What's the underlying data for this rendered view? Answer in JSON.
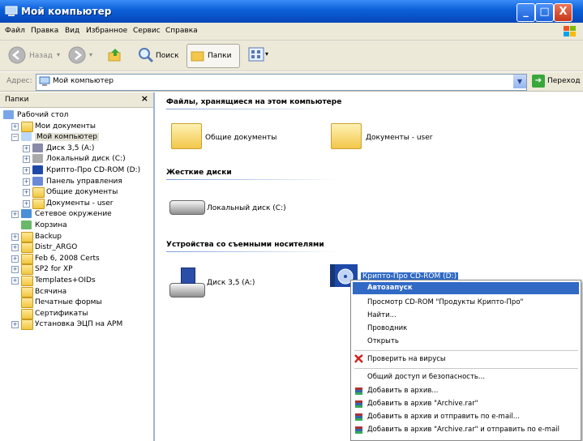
{
  "window": {
    "title": "Мой компьютер",
    "min": "_",
    "max": "□",
    "close": "X"
  },
  "menu": {
    "items": [
      "Файл",
      "Правка",
      "Вид",
      "Избранное",
      "Сервис",
      "Справка"
    ]
  },
  "toolbar": {
    "back": "Назад",
    "search": "Поиск",
    "folders": "Папки"
  },
  "address": {
    "label": "Адрес:",
    "value": "Мой компьютер",
    "go": "Переход"
  },
  "folders_pane": {
    "title": "Папки",
    "close": "×",
    "items": [
      {
        "label": "Рабочий стол"
      },
      {
        "label": "Мои документы",
        "pm": "+"
      },
      {
        "label": "Мой компьютер",
        "pm": "−"
      },
      {
        "label": "Диск 3,5 (A:)",
        "pm": "+"
      },
      {
        "label": "Локальный диск (C:)",
        "pm": "+"
      },
      {
        "label": "Крипто-Про CD-ROM (D:)",
        "pm": "+"
      },
      {
        "label": "Панель управления",
        "pm": "+"
      },
      {
        "label": "Общие документы",
        "pm": "+"
      },
      {
        "label": "Документы - user",
        "pm": "+"
      },
      {
        "label": "Сетевое окружение",
        "pm": "+"
      },
      {
        "label": "Корзина"
      },
      {
        "label": "Backup",
        "pm": "+"
      },
      {
        "label": "Distr_ARGO",
        "pm": "+"
      },
      {
        "label": "Feb 6, 2008 Certs",
        "pm": "+"
      },
      {
        "label": "SP2 for XP",
        "pm": "+"
      },
      {
        "label": "Templates+OIDs",
        "pm": "+"
      },
      {
        "label": "Всячина"
      },
      {
        "label": "Печатные формы"
      },
      {
        "label": "Сертификаты"
      },
      {
        "label": "Установка ЭЦП на АРМ",
        "pm": "+"
      }
    ]
  },
  "content": {
    "group_files": "Файлы, хранящиеся на этом компьютере",
    "shared_docs": "Общие документы",
    "user_docs": "Документы - user",
    "group_hdd": "Жесткие диски",
    "local_disk": "Локальный диск (C:)",
    "group_removable": "Устройства со съемными носителями",
    "floppy": "Диск 3,5 (A:)",
    "cdrom": "Крипто-Про CD-ROM (D:)"
  },
  "context_menu": {
    "autorun": "Автозапуск",
    "browse_cd": "Просмотр CD-ROM \"Продукты Крипто-Про\"",
    "find": "Найти...",
    "explorer": "Проводник",
    "open": "Открыть",
    "virus_check": "Проверить на вирусы",
    "sharing": "Общий доступ и безопасность...",
    "add_archive": "Добавить в архив...",
    "add_archive_rar": "Добавить в архив \"Archive.rar\"",
    "add_archive_email": "Добавить в архив и отправить по e-mail...",
    "add_archive_rar_email": "Добавить в архив \"Archive.rar\" и отправить по e-mail"
  },
  "colors": {
    "titlebar": "#0a5fd8",
    "selection": "#316ac5",
    "menu_bg": "#ece9d8"
  }
}
